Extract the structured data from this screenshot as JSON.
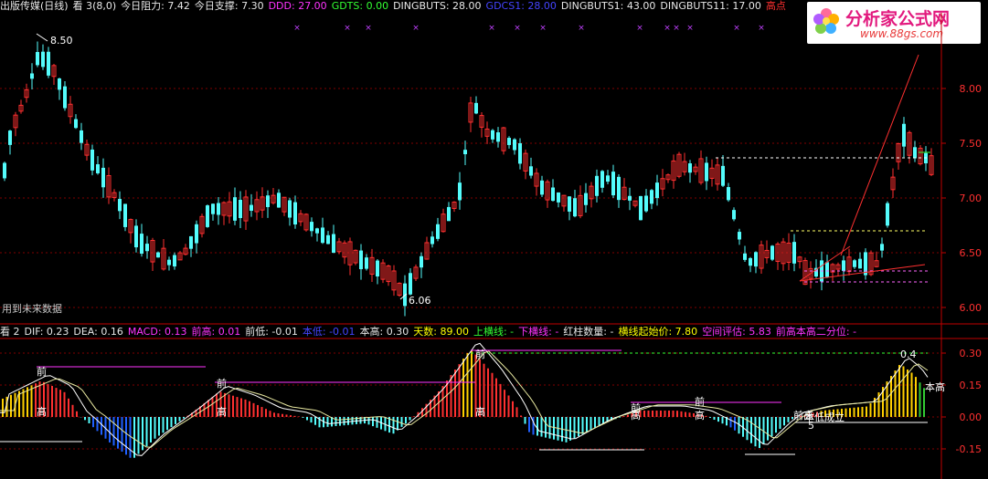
{
  "top_bar": {
    "title": "出版传媒(日线)",
    "param": "看 3(8,0)",
    "items": [
      {
        "label": "今日阻力:",
        "value": "7.42",
        "color": "#e8e8e8"
      },
      {
        "label": "今日支撑:",
        "value": "7.30",
        "color": "#e8e8e8"
      },
      {
        "label": "DDD:",
        "value": "27.00",
        "color": "#ff33ff"
      },
      {
        "label": "GDTS:",
        "value": "0.00",
        "color": "#33ff33"
      },
      {
        "label": "DINGBUTS:",
        "value": "28.00",
        "color": "#e8e8e8"
      },
      {
        "label": "GDCS1:",
        "value": "28.00",
        "color": "#4444ff"
      },
      {
        "label": "DINGBUTS1:",
        "value": "43.00",
        "color": "#e8e8e8"
      },
      {
        "label": "DINGBUTS11:",
        "value": "17.00",
        "color": "#e8e8e8"
      },
      {
        "label": "高点",
        "value": "",
        "color": "#ff3030"
      }
    ]
  },
  "logo": {
    "brand": "分析家公式网",
    "url": "www.88gs.com"
  },
  "main_chart": {
    "y_ticks": [
      "8.00",
      "7.50",
      "7.00",
      "6.50",
      "6.00"
    ],
    "high_label": "8.50",
    "low_label": "6.06",
    "note": "用到未来数据"
  },
  "sub_bar": {
    "items": [
      {
        "text": "看 2",
        "color": "#e8e8e8"
      },
      {
        "text": "DIF: 0.23",
        "color": "#e8e8e8"
      },
      {
        "text": "DEA: 0.16",
        "color": "#e8e8e8"
      },
      {
        "text": "MACD: 0.13",
        "color": "#ff33ff"
      },
      {
        "text": "前高: 0.01",
        "color": "#ff33ff"
      },
      {
        "text": "前低: -0.01",
        "color": "#e8e8e8"
      },
      {
        "text": "本低: -0.01",
        "color": "#4444ff"
      },
      {
        "text": "本高: 0.30",
        "color": "#e8e8e8"
      },
      {
        "text": "天数: 89.00",
        "color": "#ffff00"
      },
      {
        "text": "上横线: -",
        "color": "#33ff33"
      },
      {
        "text": "下横线: -",
        "color": "#ff33ff"
      },
      {
        "text": "红柱数量: -",
        "color": "#e8e8e8"
      },
      {
        "text": "横线起始价: 7.80",
        "color": "#ffff00"
      },
      {
        "text": "空间评估: 5.83",
        "color": "#ff33ff"
      },
      {
        "text": "前高本高二分位: -",
        "color": "#ff33ff"
      }
    ]
  },
  "sub_chart": {
    "y_ticks": [
      "0.30",
      "0.15",
      "0.00",
      "-0.15"
    ],
    "labels": [
      "前",
      "高",
      "前",
      "高",
      "前",
      "高",
      "前",
      "高",
      "前",
      "高",
      "前高",
      "本低成立",
      "5",
      "本高",
      "0.4"
    ]
  },
  "colors": {
    "up": "#ff3030",
    "down": "#54fcfc",
    "grid": "#800000",
    "axis": "#c00000"
  }
}
